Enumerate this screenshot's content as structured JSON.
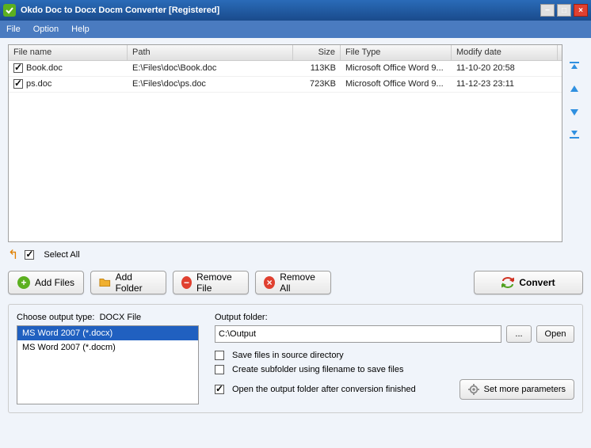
{
  "title": "Okdo Doc to Docx Docm Converter [Registered]",
  "menu": {
    "file": "File",
    "option": "Option",
    "help": "Help"
  },
  "grid": {
    "headers": {
      "name": "File name",
      "path": "Path",
      "size": "Size",
      "type": "File Type",
      "date": "Modify date"
    },
    "rows": [
      {
        "checked": true,
        "name": "Book.doc",
        "path": "E:\\Files\\doc\\Book.doc",
        "size": "113KB",
        "type": "Microsoft Office Word 9...",
        "date": "11-10-20 20:58"
      },
      {
        "checked": true,
        "name": "ps.doc",
        "path": "E:\\Files\\doc\\ps.doc",
        "size": "723KB",
        "type": "Microsoft Office Word 9...",
        "date": "11-12-23 23:11"
      }
    ]
  },
  "selectAll": {
    "label": "Select All",
    "checked": true
  },
  "buttons": {
    "addFiles": "Add Files",
    "addFolder": "Add Folder",
    "removeFile": "Remove File",
    "removeAll": "Remove All",
    "convert": "Convert"
  },
  "outputType": {
    "label": "Choose output type:",
    "current": "DOCX File",
    "options": [
      {
        "label": "MS Word 2007 (*.docx)",
        "selected": true
      },
      {
        "label": "MS Word 2007 (*.docm)",
        "selected": false
      }
    ]
  },
  "outputFolder": {
    "label": "Output folder:",
    "value": "C:\\Output",
    "browse": "...",
    "open": "Open"
  },
  "options": {
    "saveInSource": {
      "label": "Save files in source directory",
      "checked": false
    },
    "createSubfolder": {
      "label": "Create subfolder using filename to save files",
      "checked": false
    },
    "openAfter": {
      "label": "Open the output folder after conversion finished",
      "checked": true
    }
  },
  "moreParams": "Set more parameters"
}
